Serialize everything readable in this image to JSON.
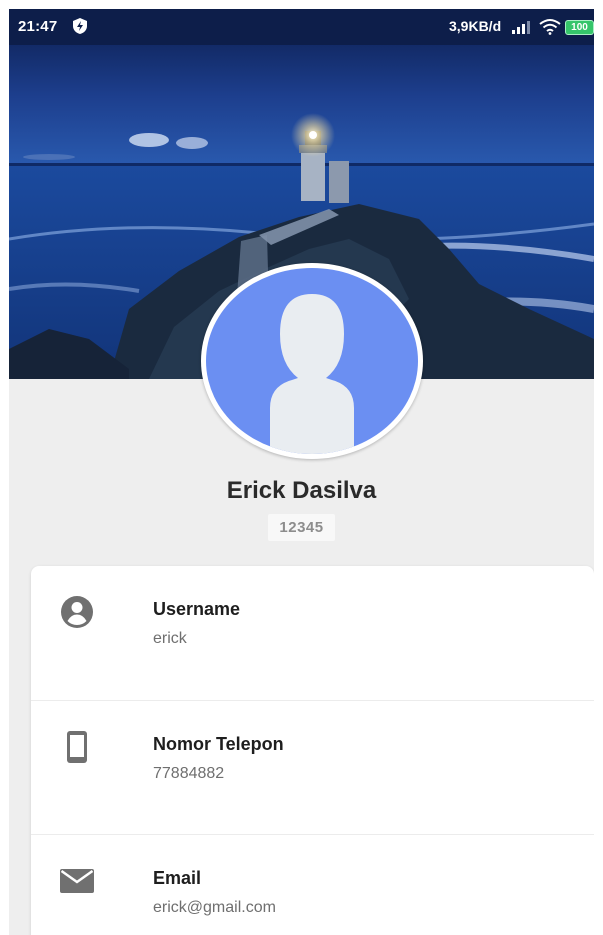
{
  "status_bar": {
    "time": "21:47",
    "network_speed": "3,9KB/d",
    "battery_level": "100",
    "icons": [
      "shield-icon",
      "signal-icon",
      "wifi-icon",
      "battery-icon"
    ]
  },
  "header": {
    "cover_image": "lighthouse-landscape",
    "avatar": "default-person-avatar"
  },
  "profile": {
    "name": "Erick Dasilva",
    "id": "12345"
  },
  "info_items": [
    {
      "icon": "account-circle-icon",
      "label": "Username",
      "value": "erick"
    },
    {
      "icon": "smartphone-icon",
      "label": "Nomor Telepon",
      "value": "77884882"
    },
    {
      "icon": "email-icon",
      "label": "Email",
      "value": "erick@gmail.com"
    }
  ],
  "colors": {
    "status_bar": "#0d1e4a",
    "avatar_background": "#6b8ff2",
    "page_background": "#eeeeee",
    "card_background": "#ffffff",
    "battery": "#35c56a"
  }
}
